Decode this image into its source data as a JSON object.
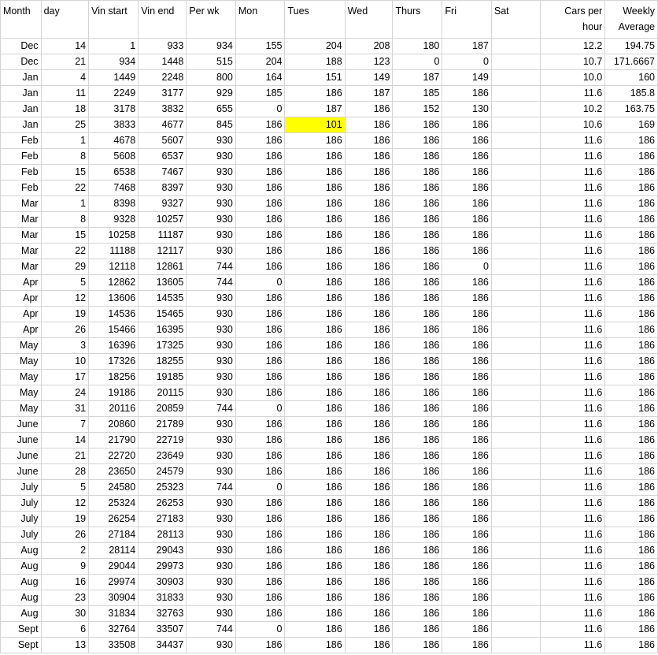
{
  "sheet": {
    "highlight_color": "#ffff00",
    "headers": [
      {
        "label": "Month",
        "align": "left"
      },
      {
        "label": "day",
        "align": "left"
      },
      {
        "label": "Vin start",
        "align": "left"
      },
      {
        "label": "Vin end",
        "align": "left"
      },
      {
        "label": "Per wk",
        "align": "left"
      },
      {
        "label": "Mon",
        "align": "left"
      },
      {
        "label": "Tues",
        "align": "left"
      },
      {
        "label": "Wed",
        "align": "left"
      },
      {
        "label": "Thurs",
        "align": "left"
      },
      {
        "label": "Fri",
        "align": "left"
      },
      {
        "label": "Sat",
        "align": "left"
      },
      {
        "label": "Cars per hour",
        "align": "right"
      },
      {
        "label": "Weekly Average",
        "align": "right"
      }
    ],
    "rows": [
      [
        "Dec",
        "14",
        "1",
        "933",
        "934",
        "155",
        "204",
        "208",
        "180",
        "187",
        "",
        "12.2",
        "194.75"
      ],
      [
        "Dec",
        "21",
        "934",
        "1448",
        "515",
        "204",
        "188",
        "123",
        "0",
        "0",
        "",
        "10.7",
        "171.6667"
      ],
      [
        "Jan",
        "4",
        "1449",
        "2248",
        "800",
        "164",
        "151",
        "149",
        "187",
        "149",
        "",
        "10.0",
        "160"
      ],
      [
        "Jan",
        "11",
        "2249",
        "3177",
        "929",
        "185",
        "186",
        "187",
        "185",
        "186",
        "",
        "11.6",
        "185.8"
      ],
      [
        "Jan",
        "18",
        "3178",
        "3832",
        "655",
        "0",
        "187",
        "186",
        "152",
        "130",
        "",
        "10.2",
        "163.75"
      ],
      [
        "Jan",
        "25",
        "3833",
        "4677",
        "845",
        "186",
        "101",
        "186",
        "186",
        "186",
        "",
        "10.6",
        "169"
      ],
      [
        "Feb",
        "1",
        "4678",
        "5607",
        "930",
        "186",
        "186",
        "186",
        "186",
        "186",
        "",
        "11.6",
        "186"
      ],
      [
        "Feb",
        "8",
        "5608",
        "6537",
        "930",
        "186",
        "186",
        "186",
        "186",
        "186",
        "",
        "11.6",
        "186"
      ],
      [
        "Feb",
        "15",
        "6538",
        "7467",
        "930",
        "186",
        "186",
        "186",
        "186",
        "186",
        "",
        "11.6",
        "186"
      ],
      [
        "Feb",
        "22",
        "7468",
        "8397",
        "930",
        "186",
        "186",
        "186",
        "186",
        "186",
        "",
        "11.6",
        "186"
      ],
      [
        "Mar",
        "1",
        "8398",
        "9327",
        "930",
        "186",
        "186",
        "186",
        "186",
        "186",
        "",
        "11.6",
        "186"
      ],
      [
        "Mar",
        "8",
        "9328",
        "10257",
        "930",
        "186",
        "186",
        "186",
        "186",
        "186",
        "",
        "11.6",
        "186"
      ],
      [
        "Mar",
        "15",
        "10258",
        "11187",
        "930",
        "186",
        "186",
        "186",
        "186",
        "186",
        "",
        "11.6",
        "186"
      ],
      [
        "Mar",
        "22",
        "11188",
        "12117",
        "930",
        "186",
        "186",
        "186",
        "186",
        "186",
        "",
        "11.6",
        "186"
      ],
      [
        "Mar",
        "29",
        "12118",
        "12861",
        "744",
        "186",
        "186",
        "186",
        "186",
        "0",
        "",
        "11.6",
        "186"
      ],
      [
        "Apr",
        "5",
        "12862",
        "13605",
        "744",
        "0",
        "186",
        "186",
        "186",
        "186",
        "",
        "11.6",
        "186"
      ],
      [
        "Apr",
        "12",
        "13606",
        "14535",
        "930",
        "186",
        "186",
        "186",
        "186",
        "186",
        "",
        "11.6",
        "186"
      ],
      [
        "Apr",
        "19",
        "14536",
        "15465",
        "930",
        "186",
        "186",
        "186",
        "186",
        "186",
        "",
        "11.6",
        "186"
      ],
      [
        "Apr",
        "26",
        "15466",
        "16395",
        "930",
        "186",
        "186",
        "186",
        "186",
        "186",
        "",
        "11.6",
        "186"
      ],
      [
        "May",
        "3",
        "16396",
        "17325",
        "930",
        "186",
        "186",
        "186",
        "186",
        "186",
        "",
        "11.6",
        "186"
      ],
      [
        "May",
        "10",
        "17326",
        "18255",
        "930",
        "186",
        "186",
        "186",
        "186",
        "186",
        "",
        "11.6",
        "186"
      ],
      [
        "May",
        "17",
        "18256",
        "19185",
        "930",
        "186",
        "186",
        "186",
        "186",
        "186",
        "",
        "11.6",
        "186"
      ],
      [
        "May",
        "24",
        "19186",
        "20115",
        "930",
        "186",
        "186",
        "186",
        "186",
        "186",
        "",
        "11.6",
        "186"
      ],
      [
        "May",
        "31",
        "20116",
        "20859",
        "744",
        "0",
        "186",
        "186",
        "186",
        "186",
        "",
        "11.6",
        "186"
      ],
      [
        "June",
        "7",
        "20860",
        "21789",
        "930",
        "186",
        "186",
        "186",
        "186",
        "186",
        "",
        "11.6",
        "186"
      ],
      [
        "June",
        "14",
        "21790",
        "22719",
        "930",
        "186",
        "186",
        "186",
        "186",
        "186",
        "",
        "11.6",
        "186"
      ],
      [
        "June",
        "21",
        "22720",
        "23649",
        "930",
        "186",
        "186",
        "186",
        "186",
        "186",
        "",
        "11.6",
        "186"
      ],
      [
        "June",
        "28",
        "23650",
        "24579",
        "930",
        "186",
        "186",
        "186",
        "186",
        "186",
        "",
        "11.6",
        "186"
      ],
      [
        "July",
        "5",
        "24580",
        "25323",
        "744",
        "0",
        "186",
        "186",
        "186",
        "186",
        "",
        "11.6",
        "186"
      ],
      [
        "July",
        "12",
        "25324",
        "26253",
        "930",
        "186",
        "186",
        "186",
        "186",
        "186",
        "",
        "11.6",
        "186"
      ],
      [
        "July",
        "19",
        "26254",
        "27183",
        "930",
        "186",
        "186",
        "186",
        "186",
        "186",
        "",
        "11.6",
        "186"
      ],
      [
        "July",
        "26",
        "27184",
        "28113",
        "930",
        "186",
        "186",
        "186",
        "186",
        "186",
        "",
        "11.6",
        "186"
      ],
      [
        "Aug",
        "2",
        "28114",
        "29043",
        "930",
        "186",
        "186",
        "186",
        "186",
        "186",
        "",
        "11.6",
        "186"
      ],
      [
        "Aug",
        "9",
        "29044",
        "29973",
        "930",
        "186",
        "186",
        "186",
        "186",
        "186",
        "",
        "11.6",
        "186"
      ],
      [
        "Aug",
        "16",
        "29974",
        "30903",
        "930",
        "186",
        "186",
        "186",
        "186",
        "186",
        "",
        "11.6",
        "186"
      ],
      [
        "Aug",
        "23",
        "30904",
        "31833",
        "930",
        "186",
        "186",
        "186",
        "186",
        "186",
        "",
        "11.6",
        "186"
      ],
      [
        "Aug",
        "30",
        "31834",
        "32763",
        "930",
        "186",
        "186",
        "186",
        "186",
        "186",
        "",
        "11.6",
        "186"
      ],
      [
        "Sept",
        "6",
        "32764",
        "33507",
        "744",
        "0",
        "186",
        "186",
        "186",
        "186",
        "",
        "11.6",
        "186"
      ],
      [
        "Sept",
        "13",
        "33508",
        "34437",
        "930",
        "186",
        "186",
        "186",
        "186",
        "186",
        "",
        "11.6",
        "186"
      ]
    ],
    "highlighted_cells": [
      {
        "row": 5,
        "col": 6
      }
    ]
  }
}
